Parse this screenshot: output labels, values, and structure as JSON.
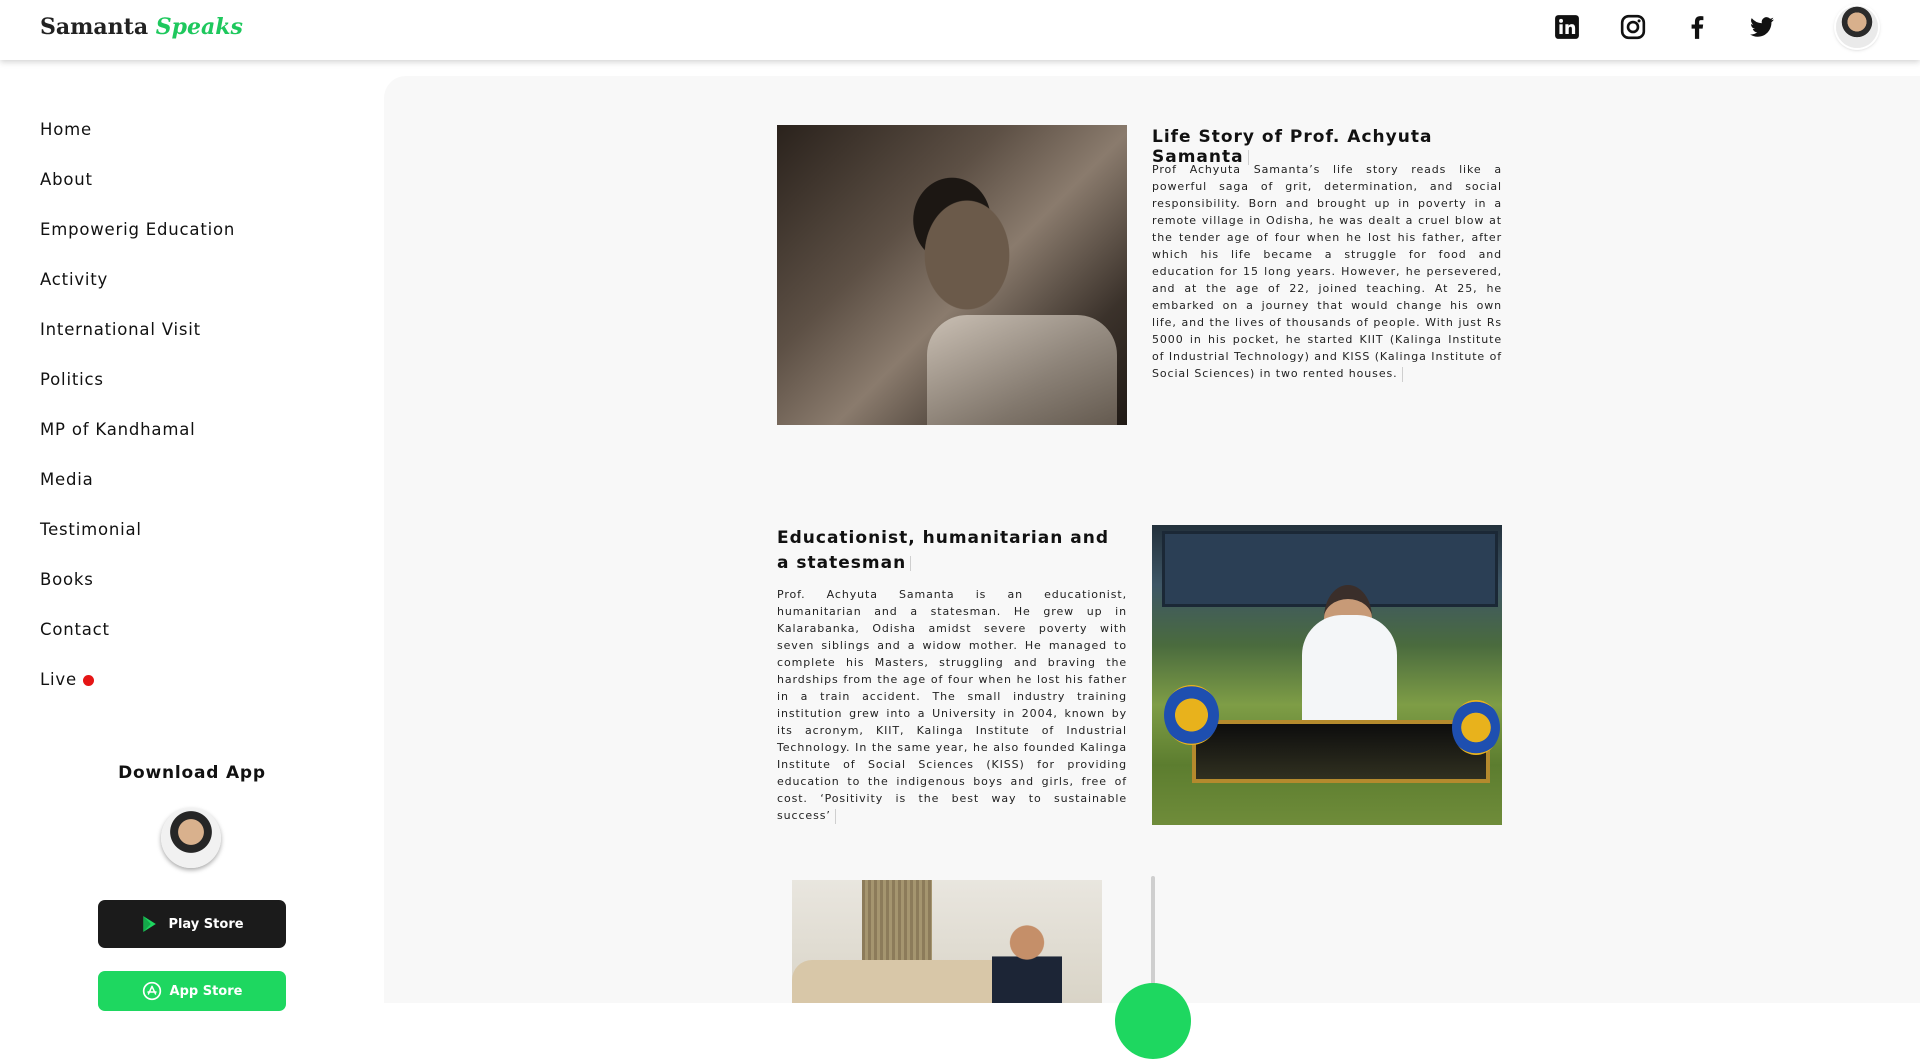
{
  "header": {
    "brand_main": "Samanta",
    "brand_accent": "Speaks",
    "social_icons": [
      "linkedin-icon",
      "instagram-icon",
      "facebook-icon",
      "twitter-icon"
    ]
  },
  "sidebar": {
    "items": [
      {
        "label": "Home"
      },
      {
        "label": "About"
      },
      {
        "label": "Empowerig Education"
      },
      {
        "label": "Activity"
      },
      {
        "label": "International Visit"
      },
      {
        "label": "Politics"
      },
      {
        "label": "MP of Kandhamal"
      },
      {
        "label": "Media"
      },
      {
        "label": "Testimonial"
      },
      {
        "label": "Books"
      },
      {
        "label": "Contact"
      },
      {
        "label": "Live"
      }
    ],
    "download_title": "Download App",
    "play_store_label": "Play Store",
    "app_store_label": "App Store"
  },
  "articles": [
    {
      "title": "Life Story of Prof. Achyuta Samanta",
      "body": "Prof Achyuta Samanta’s life story reads like a powerful saga of grit, determination, and social responsibility. Born and brought up in poverty in a remote village in Odisha, he was dealt a cruel blow at the tender age of four when he lost his father, after which his life became a struggle for food and education for 15 long years. However, he persevered, and at the age of 22, joined teaching. At 25, he embarked on a journey that would change his own life, and the lives of thousands of people. With just Rs 5000 in his pocket, he started KIIT (Kalinga Institute of Industrial Technology) and KISS (Kalinga Institute of Social Sciences) in two rented houses."
    },
    {
      "title": "Educationist, humanitarian and a statesman",
      "body": "Prof. Achyuta Samanta is an educationist, humanitarian and a statesman. He grew up in Kalarabanka, Odisha amidst severe poverty with seven siblings and a widow mother. He managed to complete his Masters, struggling and braving the hardships from the age of four when he lost his father in a train accident. The small industry training institution grew into a University in 2004, known by its acronym, KIIT, Kalinga Institute of Industrial Technology. In the same year, he also founded Kalinga Institute of Social Sciences (KISS) for providing education to the indigenous boys and girls, free of cost. ‘Positivity is the best way to sustainable success’"
    }
  ],
  "colors": {
    "accent_green": "#1ec85d",
    "live_red": "#e51515",
    "play_store_bg": "#1b1b1b",
    "app_store_bg": "#1ed760"
  }
}
